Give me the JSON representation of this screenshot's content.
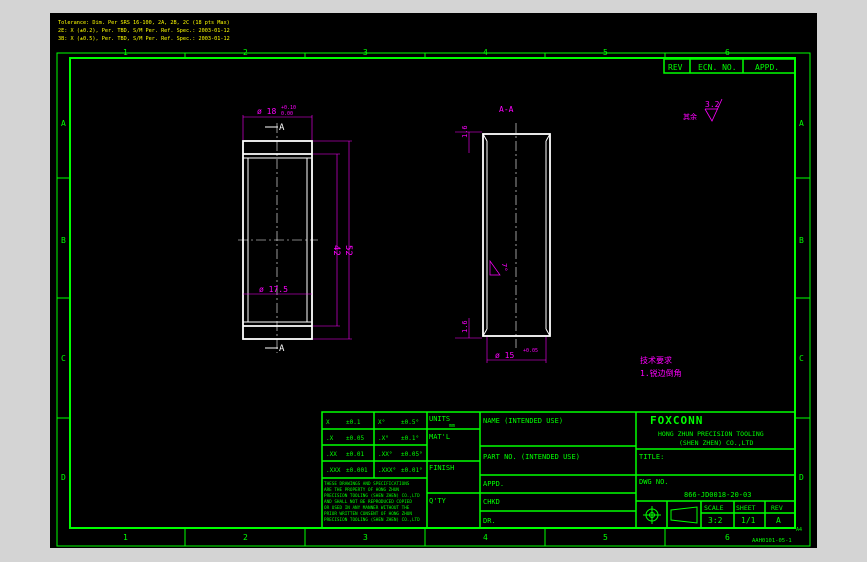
{
  "colors": {
    "sheet": "#000000",
    "border": "#00ff00",
    "part": "#ffffff",
    "dimension": "#ff00ff",
    "note": "#ffff00",
    "background": "#d4d4d4"
  },
  "header_notes": [
    "Tolerance: Dim. Per SRS 16-100, 2A, 2B, 2C (18 pts Max)",
    "2E: X (±0.2), Per. TBD, S/M Per. Ref. Spec.: 2003-01-12",
    "3B: X (±0.5), Per. TBD, S/M Per. Ref. Spec.: 2003-01-12"
  ],
  "zone_columns": [
    "1",
    "2",
    "3",
    "4",
    "5",
    "6"
  ],
  "zone_rows": [
    "A",
    "B",
    "C",
    "D"
  ],
  "revision_block": {
    "rev": "REV",
    "ecn": "ECN. NO.",
    "appd": "APPD."
  },
  "left_view": {
    "dia_top": "ø 18",
    "dia_top_tol_upper": "+0.10",
    "dia_top_tol_lower": "0.00",
    "section_top": "A",
    "dia_mid": "ø 17.5",
    "len_inner": "42",
    "len_overall": "52",
    "section_bottom": "A"
  },
  "right_view": {
    "title": "A-A",
    "chamfer_top": "1.6",
    "chamfer_bottom": "1.6",
    "angle": "7°",
    "dia_bore": "ø 15",
    "dia_bore_tol": "+0.05"
  },
  "surface_finish": {
    "value": "3.2",
    "label": "其余"
  },
  "notes_block": {
    "title": "技术要求",
    "line1": "1.锐边倒角"
  },
  "tolerance_table": {
    "rows": [
      {
        "lin": "X",
        "lin_tol": "±0.1",
        "ang": "X°",
        "ang_tol": "±0.5°"
      },
      {
        "lin": ".X",
        "lin_tol": "±0.05",
        "ang": ".X°",
        "ang_tol": "±0.1°"
      },
      {
        "lin": ".XX",
        "lin_tol": "±0.01",
        "ang": ".XX°",
        "ang_tol": "±0.05°"
      },
      {
        "lin": ".XXX",
        "lin_tol": "±0.001",
        "ang": ".XXX°",
        "ang_tol": "±0.01°"
      }
    ],
    "disclaimer": [
      "THESE DRAWINGS AND SPECIFICATIONS",
      "ARE THE PROPERTY OF HONG ZHUN",
      "PRECISION TOOLING (SHEN ZHEN) CO.,LTD",
      "AND SHALL NOT BE REPRODUCED COPIED",
      "OR USED IN ANY MANNER WITHOUT THE",
      "PRIOR WRITTEN CONSENT OF HONG ZHUN",
      "PRECISION TOOLING (SHEN ZHEN) CO.,LTD"
    ]
  },
  "title_block": {
    "units": "UNITS",
    "units_val": "mm",
    "matl": "MAT'L",
    "finish": "FINISH",
    "qty": "Q'TY",
    "name": "NAME (INTENDED USE)",
    "part_no": "PART NO. (INTENDED USE)",
    "appd": "APPD.",
    "chkd": "CHKD",
    "dr": "DR.",
    "brand": "FOXCONN",
    "company1": "HONG ZHUN PRECISION TOOLING",
    "company2": "(SHEN ZHEN) CO.,LTD",
    "title_label": "TITLE:",
    "dwg_label": "DWG NO.",
    "dwg_no": "866-JD0018-20-03",
    "scale_label": "SCALE",
    "scale": "3:2",
    "sheet_label": "SHEET",
    "sheet": "1/1",
    "rev_label": "REV",
    "rev": "A",
    "size": "A4",
    "form_no": "AAH0101-05-1"
  }
}
